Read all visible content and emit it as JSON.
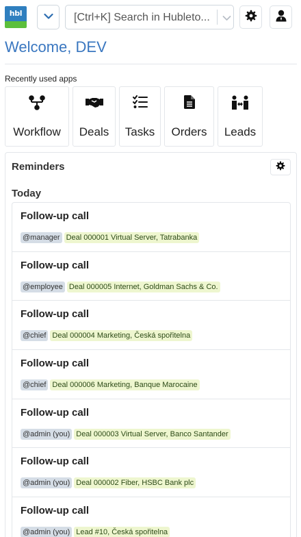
{
  "header": {
    "logo_text": "hbl",
    "search_placeholder": "[Ctrl+K] Search in Hubleto..."
  },
  "welcome": "Welcome, DEV",
  "recent_apps": {
    "label": "Recently used apps",
    "apps": [
      {
        "label": "Workflow",
        "icon": "workflow-icon"
      },
      {
        "label": "Deals",
        "icon": "handshake-icon"
      },
      {
        "label": "Tasks",
        "icon": "tasks-icon"
      },
      {
        "label": "Orders",
        "icon": "document-icon"
      },
      {
        "label": "Leads",
        "icon": "people-arrows-icon"
      }
    ]
  },
  "reminders": {
    "title": "Reminders",
    "group": "Today",
    "items": [
      {
        "title": "Follow-up call",
        "user": "@manager",
        "ref": "Deal 000001 Virtual Server, Tatrabanka"
      },
      {
        "title": "Follow-up call",
        "user": "@employee",
        "ref": "Deal 000005 Internet, Goldman Sachs & Co."
      },
      {
        "title": "Follow-up call",
        "user": "@chief",
        "ref": "Deal 000004 Marketing, Česká spořitelna"
      },
      {
        "title": "Follow-up call",
        "user": "@chief",
        "ref": "Deal 000006 Marketing, Banque Marocaine"
      },
      {
        "title": "Follow-up call",
        "user": "@admin (you)",
        "ref": "Deal 000003 Virtual Server, Banco Santander"
      },
      {
        "title": "Follow-up call",
        "user": "@admin (you)",
        "ref": "Deal 000002 Fiber, HSBC Bank plc"
      },
      {
        "title": "Follow-up call",
        "user": "@admin (you)",
        "ref": "Lead #10, Česká spořitelna"
      }
    ]
  },
  "colors": {
    "accent": "#3a77c0",
    "logo_blue": "#2f7fbf",
    "logo_green": "#5cbf3b",
    "user_tag": "#d5dde6",
    "ref_tag": "#eef6cf"
  }
}
